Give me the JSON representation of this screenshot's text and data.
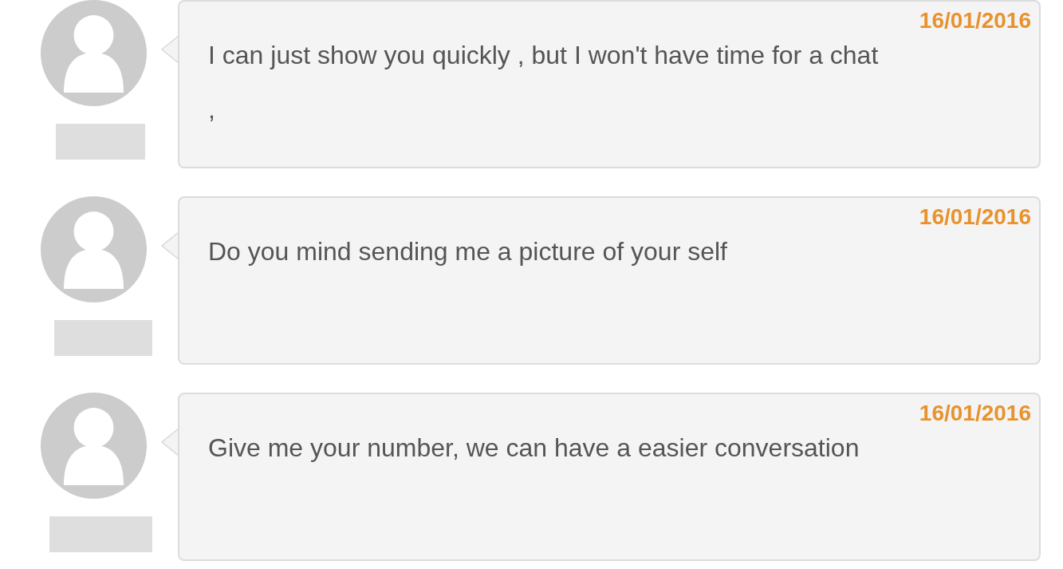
{
  "messages": [
    {
      "date": "16/01/2016",
      "text": "I can just show you quickly , but I won't have time for a chat ,"
    },
    {
      "date": "16/01/2016",
      "text": "Do you mind sending me a picture of your self"
    },
    {
      "date": "16/01/2016",
      "text": "Give me your number, we can have a easier conversation"
    }
  ]
}
